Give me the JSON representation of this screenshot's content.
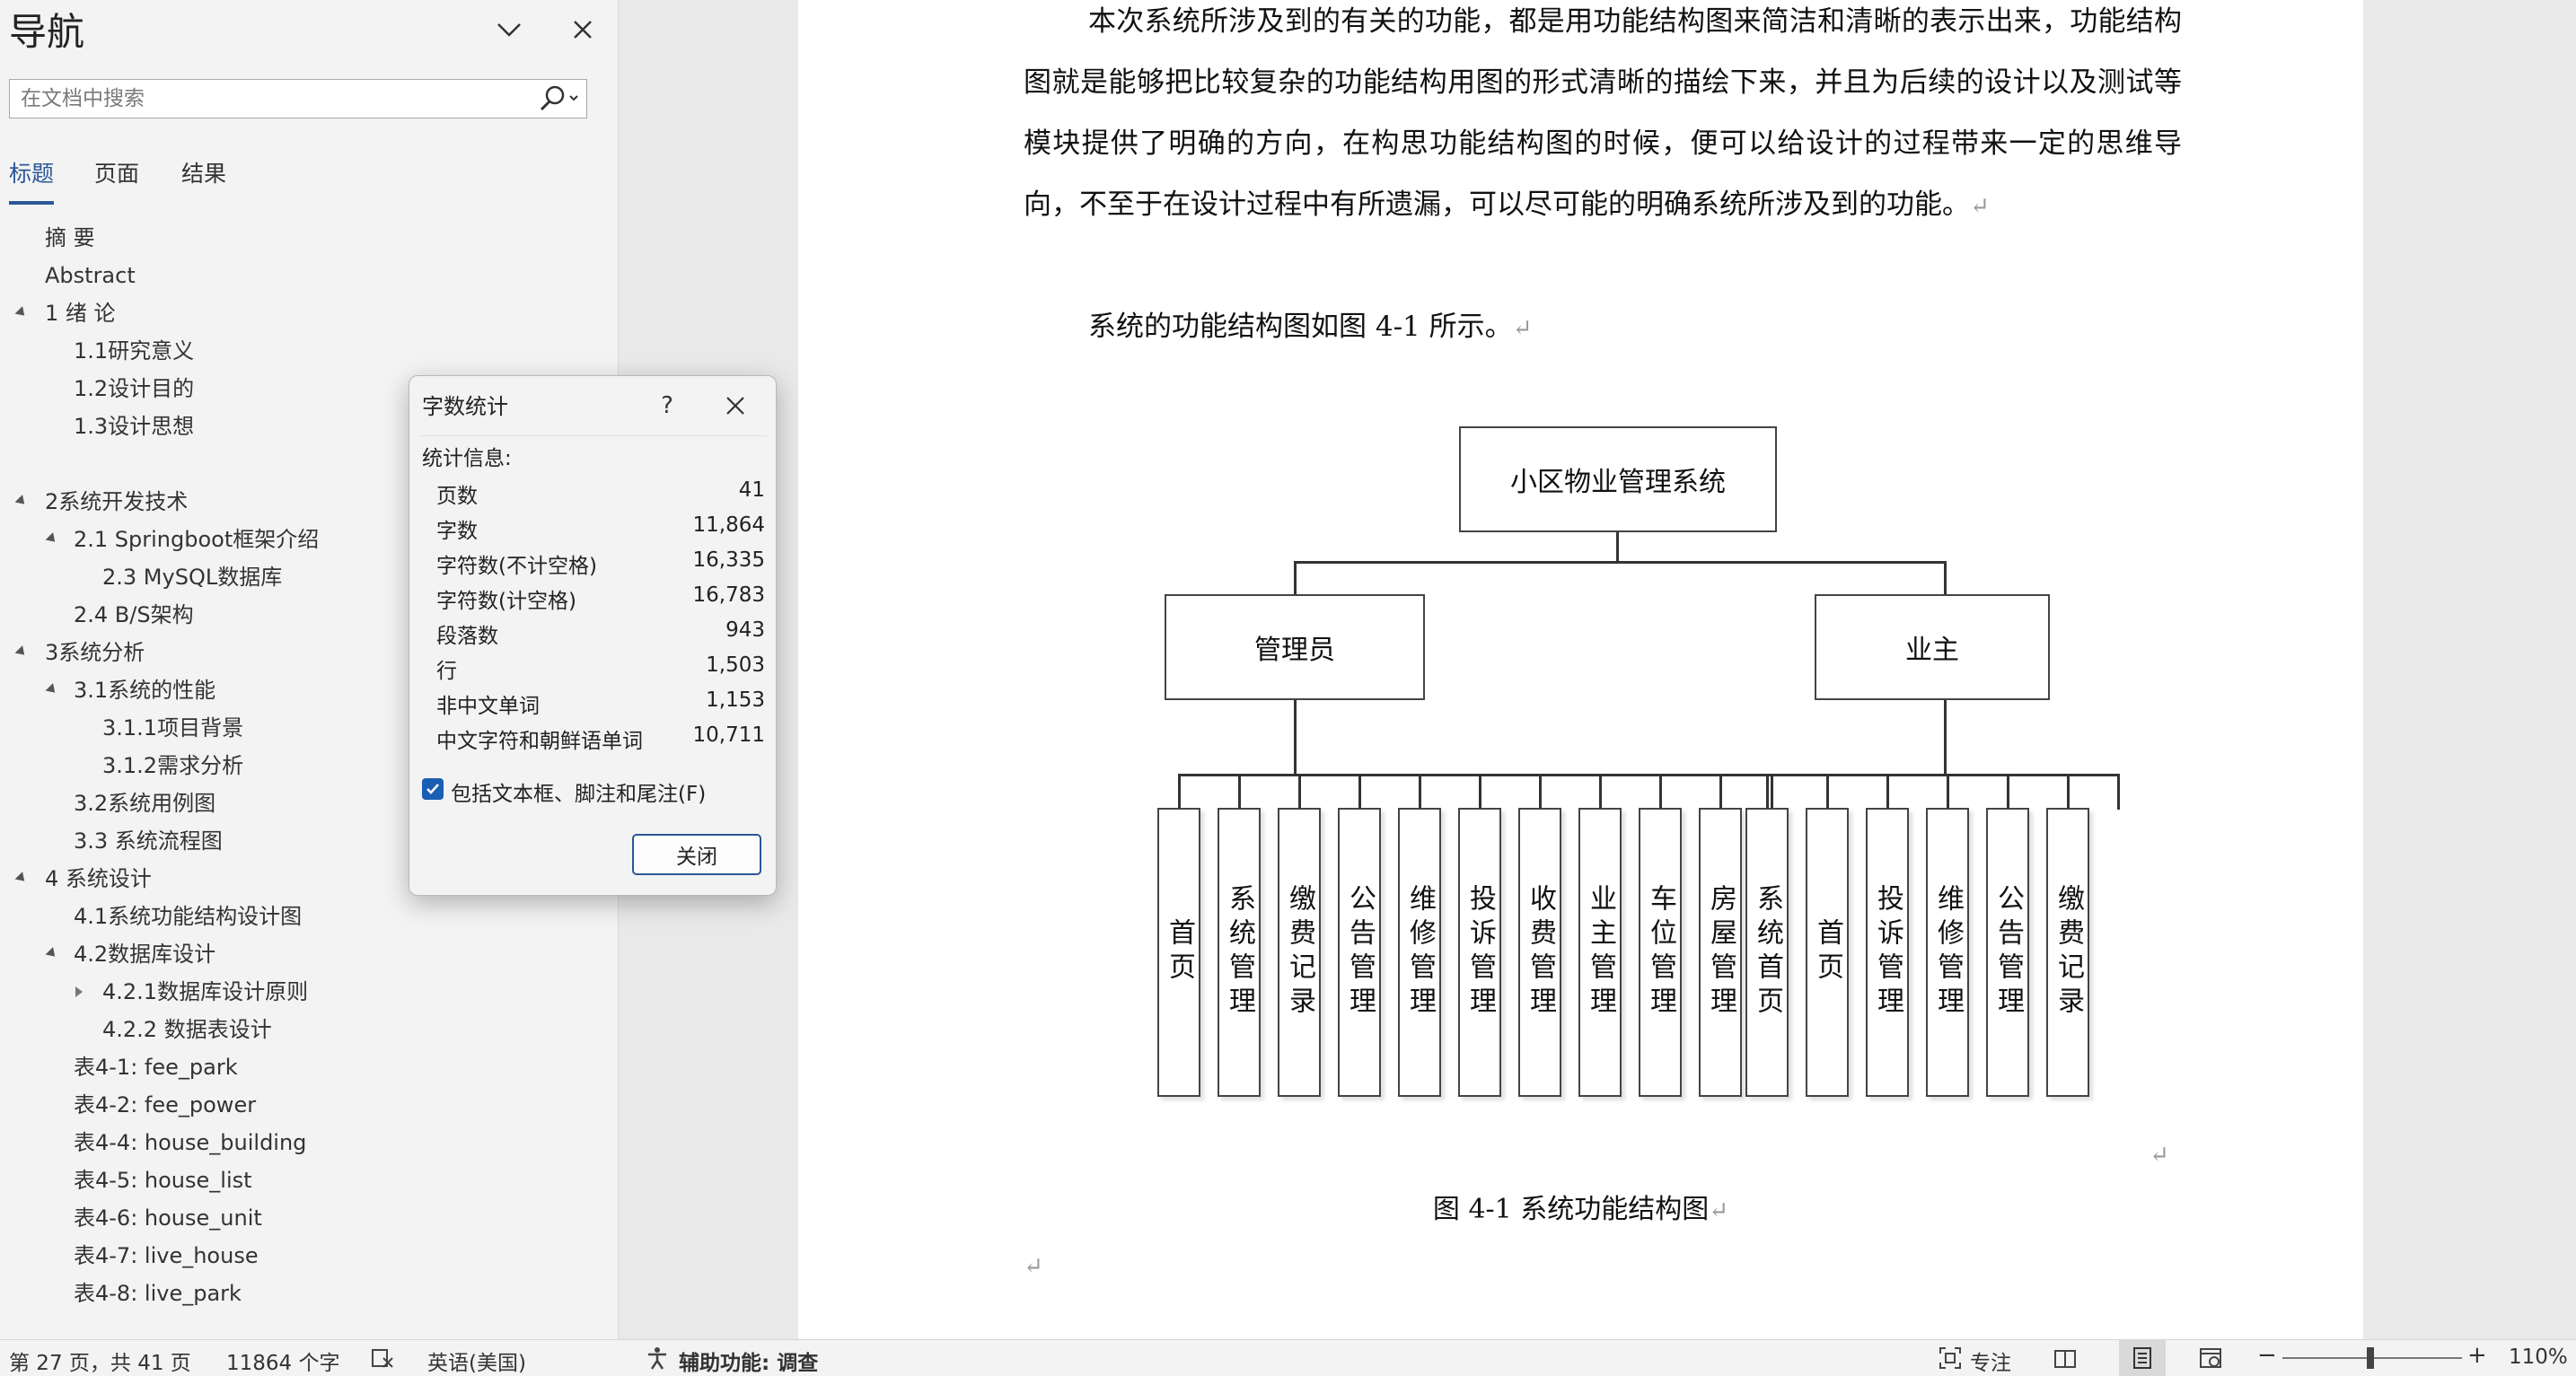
{
  "nav": {
    "title": "导航",
    "search_placeholder": "在文档中搜索",
    "tabs": [
      "标题",
      "页面",
      "结果"
    ],
    "tree": [
      {
        "label": "摘  要"
      },
      {
        "label": "Abstract"
      },
      {
        "label": "1 绪  论"
      },
      {
        "label": "1.1研究意义"
      },
      {
        "label": "1.2设计目的"
      },
      {
        "label": "1.3设计思想"
      },
      {
        "label": "2系统开发技术"
      },
      {
        "label": "2.1 Springboot框架介绍"
      },
      {
        "label": "2.3 MySQL数据库"
      },
      {
        "label": "2.4 B/S架构"
      },
      {
        "label": "3系统分析"
      },
      {
        "label": "3.1系统的性能"
      },
      {
        "label": "3.1.1项目背景"
      },
      {
        "label": "3.1.2需求分析"
      },
      {
        "label": "3.2系统用例图"
      },
      {
        "label": "3.3 系统流程图"
      },
      {
        "label": "4 系统设计"
      },
      {
        "label": "4.1系统功能结构设计图"
      },
      {
        "label": "4.2数据库设计"
      },
      {
        "label": "4.2.1数据库设计原则"
      },
      {
        "label": "4.2.2  数据表设计"
      },
      {
        "label": "表4-1: fee_park"
      },
      {
        "label": "表4-2: fee_power"
      },
      {
        "label": "表4-4: house_building"
      },
      {
        "label": "表4-5: house_list"
      },
      {
        "label": "表4-6: house_unit"
      },
      {
        "label": "表4-7: live_house"
      },
      {
        "label": "表4-8: live_park"
      }
    ]
  },
  "document": {
    "para1": "本次系统所涉及到的有关的功能，都是用功能结构图来简洁和清晰的表示出来，功能结构图就是能够把比较复杂的功能结构用图的形式清晰的描绘下来，并且为后续的设计以及测试等模块提供了明确的方向，在构思功能结构图的时候，便可以给设计的过程带来一定的思维导向，不至于在设计过程中有所遗漏，可以尽可能的明确系统所涉及到的功能。",
    "para2": "系统的功能结构图如图 4-1 所示。",
    "para_mark": "↵",
    "figure": {
      "root": "小区物业管理系统",
      "left": "管理员",
      "right": "业主",
      "left_children": [
        "首页",
        "系统管理",
        "缴费记录",
        "公告管理",
        "维修管理",
        "投诉管理",
        "收费管理",
        "业主管理",
        "车位管理",
        "房屋管理"
      ],
      "right_children": [
        "系统首页",
        "首页",
        "投诉管理",
        "维修管理",
        "公告管理",
        "缴费记录"
      ]
    },
    "caption": "图  4-1 系统功能结构图"
  },
  "dialog": {
    "title": "字数统计",
    "help": "?",
    "section": "统计信息:",
    "stats": [
      {
        "label": "页数",
        "value": "41"
      },
      {
        "label": "字数",
        "value": "11,864"
      },
      {
        "label": "字符数(不计空格)",
        "value": "16,335"
      },
      {
        "label": "字符数(计空格)",
        "value": "16,783"
      },
      {
        "label": "段落数",
        "value": "943"
      },
      {
        "label": "行",
        "value": "1,503"
      },
      {
        "label": "非中文单词",
        "value": "1,153"
      },
      {
        "label": "中文字符和朝鲜语单词",
        "value": "10,711"
      }
    ],
    "checkbox_label": "包括文本框、脚注和尾注(F)",
    "checkbox_checked": true,
    "close_label": "关闭"
  },
  "status": {
    "page": "第 27 页，共 41 页",
    "words": "11864 个字",
    "language": "英语(美国)",
    "accessibility": "辅助功能: 调查",
    "focus": "专注",
    "zoom": "110%",
    "zoom_minus": "−",
    "zoom_plus": "+"
  },
  "colors": {
    "accent": "#2b5797",
    "selection": "#cddcf0",
    "checkbox": "#1a5fb4"
  }
}
